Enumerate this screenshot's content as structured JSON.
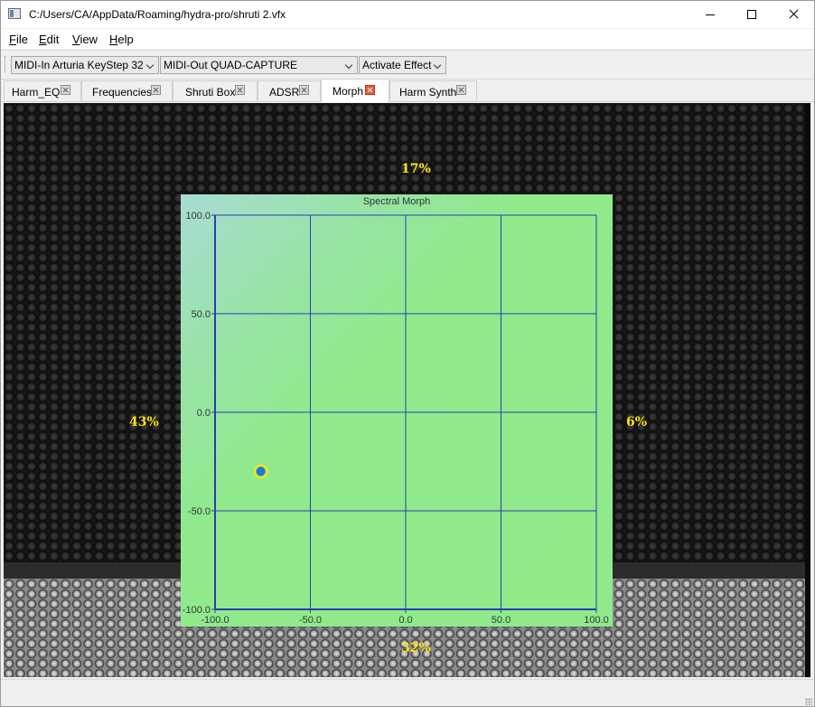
{
  "window": {
    "title": "C:/Users/CA/AppData/Roaming/hydra-pro/shruti 2.vfx"
  },
  "menu": [
    "File",
    "Edit",
    "View",
    "Help"
  ],
  "toolbar": {
    "midi_in": "MIDI-In Arturia KeyStep 32",
    "midi_out": "MIDI-Out QUAD-CAPTURE",
    "effect": "Activate Effect"
  },
  "tabs": [
    {
      "label": "Harm_EQ",
      "active": false
    },
    {
      "label": "Frequencies",
      "active": false
    },
    {
      "label": "Shruti Box",
      "active": false
    },
    {
      "label": "ADSR",
      "active": false
    },
    {
      "label": "Morph",
      "active": true
    },
    {
      "label": "Harm Synth",
      "active": false
    }
  ],
  "morph": {
    "top_percent": "17%",
    "left_percent": "43%",
    "right_percent": "6%",
    "bottom_percent": "32%"
  },
  "chart_data": {
    "type": "scatter",
    "title": "Spectral Morph",
    "xlabel": "",
    "ylabel": "",
    "xlim": [
      -100,
      100
    ],
    "ylim": [
      -100,
      100
    ],
    "x_ticks": [
      "-100.0",
      "-50.0",
      "0.0",
      "50.0",
      "100.0"
    ],
    "y_ticks": [
      "100.0",
      "50.0",
      "0.0",
      "-50.0",
      "-100.0"
    ],
    "grid": true,
    "points": [
      {
        "x": -76,
        "y": -30
      }
    ],
    "colors": {
      "grid": "#2a3cb4",
      "point_fill": "#1e7ad8",
      "point_ring": "#f2ea1e"
    }
  }
}
